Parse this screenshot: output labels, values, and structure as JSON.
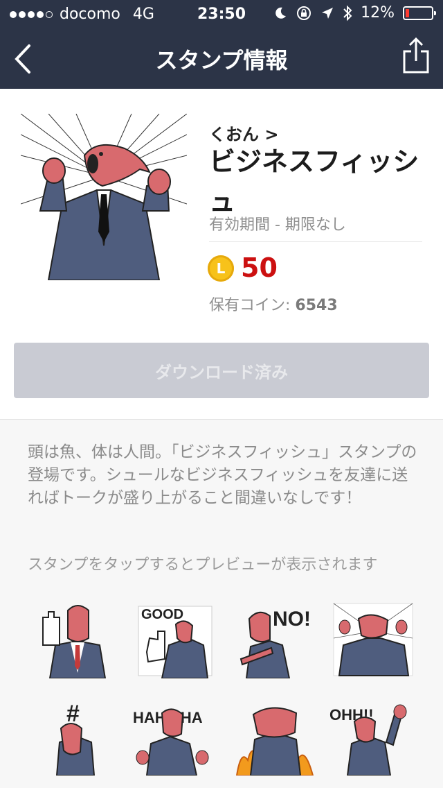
{
  "status_bar": {
    "carrier": "docomo",
    "network": "4G",
    "time": "23:50",
    "battery": "12%",
    "battery_level": 0.12,
    "icons": [
      "moon-icon",
      "rotation-lock-icon",
      "location-icon",
      "bluetooth-icon"
    ]
  },
  "nav": {
    "title": "スタンプ情報",
    "back_icon": "chevron-left-icon",
    "share_icon": "share-icon"
  },
  "product": {
    "author": "くおん >",
    "name": "ビジネスフィッシュ",
    "validity": "有効期間 - 期限なし",
    "coin_letter": "L",
    "price": "50",
    "owned_label": "保有コイン: ",
    "owned_value": "6543",
    "download_button": "ダウンロード済み"
  },
  "description": "頭は魚、体は人間。「ビジネスフィッシュ」スタンプの登場です。シュールなビジネスフィッシュを友達に送ればトークが盛り上がること間違いなしです！",
  "preview_hint": "スタンプをタップするとプレビューが表示されます",
  "stickers": [
    {
      "text": ""
    },
    {
      "text": "GOOD"
    },
    {
      "text": "NO!"
    },
    {
      "text": ""
    },
    {
      "text": "#"
    },
    {
      "text": "HAHA HA"
    },
    {
      "text": ""
    },
    {
      "text": "OHH!!"
    }
  ],
  "colors": {
    "nav_bg": "#2c3447",
    "price": "#cc1010",
    "coin": "#f7c21a",
    "button_disabled": "#c9cbd3",
    "fish": "#d86a6e",
    "suit": "#4f5d7e"
  }
}
